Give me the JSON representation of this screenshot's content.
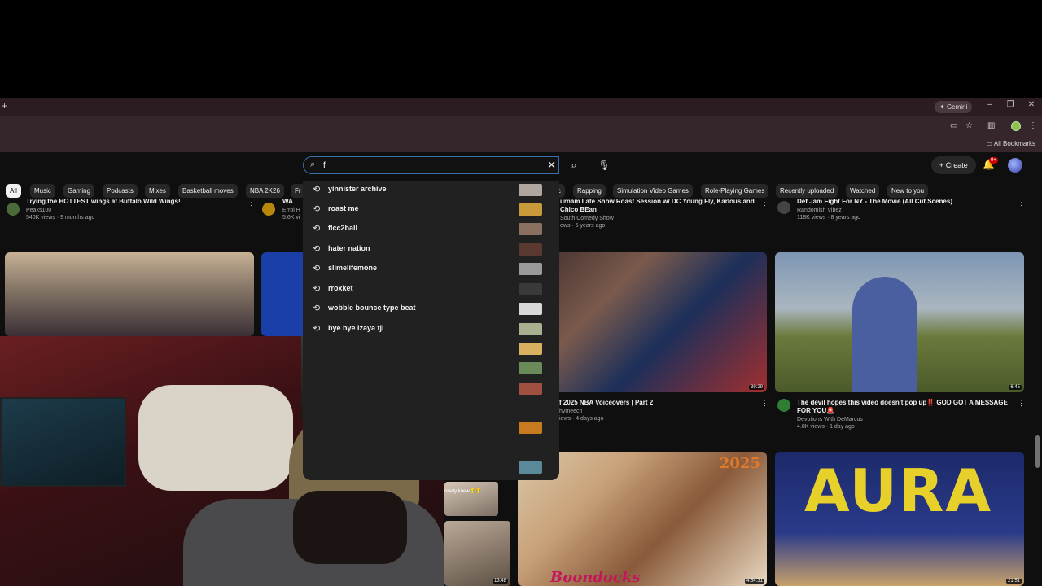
{
  "browser": {
    "gemini_label": "Gemini",
    "all_bookmarks": "All Bookmarks"
  },
  "search": {
    "query": "f",
    "suggestions": [
      "yinnister archive",
      "roast me",
      "flcc2ball",
      "hater nation",
      "slimelifemone",
      "rroxket",
      "wobble bounce type beat",
      "bye bye izaya tji"
    ]
  },
  "header": {
    "create_label": "Create",
    "notification_count": "9+"
  },
  "chips": [
    "All",
    "Music",
    "Gaming",
    "Podcasts",
    "Mixes",
    "Basketball moves",
    "NBA 2K26",
    "Fr",
    "c",
    "Rapping",
    "Simulation Video Games",
    "Role-Playing Games",
    "Recently uploaded",
    "Watched",
    "New to you"
  ],
  "row1": [
    {
      "title": "Trying the HOTTEST wings at Buffalo Wild Wings!",
      "channel": "Peaks100",
      "stats": "540K views · 9 months ago"
    },
    {
      "title": "WA",
      "channel": "Errol H",
      "stats": "5.6K vi"
    },
    {
      "title": "urnam Late Show Roast Session w/ DC Young Fly, Karlous and Chico BEan",
      "channel": "South Comedy Show",
      "stats": "ews · 6 years ago"
    },
    {
      "title": "Def Jam Fight For NY - The Movie (All Cut Scenes)",
      "channel": "Randomish Vibez",
      "stats": "118K views · 8 years ago"
    }
  ],
  "row2": [
    {
      "title": "f 2025 NBA Voiceovers | Part 2",
      "channel": "hymeech",
      "stats": "iews · 4 days ago",
      "duration": "39:29"
    },
    {
      "title": "The devil hopes this video doesn't pop up‼️ GOD GOT A MESSAGE FOR YOU🚨",
      "channel": "Devotions With DeMarcus",
      "stats": "4.8K views · 1 day ago",
      "duration": "6:45"
    }
  ],
  "row3": {
    "durations": [
      "13:48",
      "4:54:31",
      "21:51"
    ],
    "aura_text": "AURA",
    "boondocks_text": "Boondocks",
    "year_text": "2025",
    "cam_caption": "ready knew😂😂"
  }
}
